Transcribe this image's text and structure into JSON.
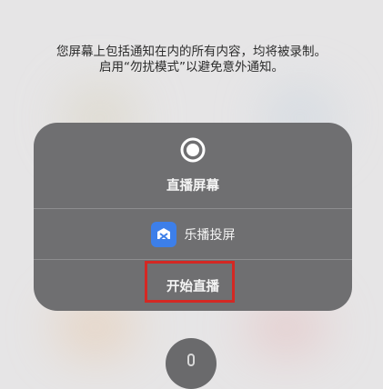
{
  "notice": {
    "line1": "您屏幕上包括通知在内的所有内容，均将被录制。",
    "line2": "启用“勿扰模式”以避免意外通知。"
  },
  "panel": {
    "title": "直播屏幕",
    "app_name": "乐播投屏",
    "start_label": "开始直播"
  },
  "colors": {
    "panel": "#6f6f71",
    "app_icon": "#3d7fe9",
    "highlight": "#d42823"
  },
  "icons": {
    "record": "record-icon",
    "app": "lebo-app-icon",
    "microphone": "microphone-icon"
  }
}
